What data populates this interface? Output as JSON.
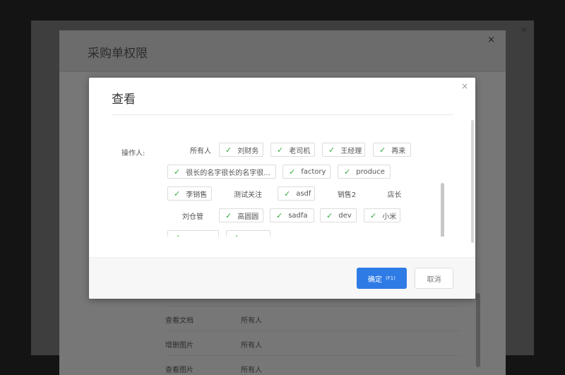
{
  "background_modal": {
    "title": "采购单权限",
    "close_icon": "×",
    "rows": [
      {
        "key": "查看文档",
        "value": "所有人"
      },
      {
        "key": "增删图片",
        "value": "所有人"
      },
      {
        "key": "查看图片",
        "value": "所有人"
      }
    ]
  },
  "dialog": {
    "title": "查看",
    "close_icon": "×",
    "field_label": "操作人:",
    "options": [
      {
        "label": "所有人",
        "checked": false
      },
      {
        "label": "刘财务",
        "checked": true
      },
      {
        "label": "老司机",
        "checked": true
      },
      {
        "label": "王经理",
        "checked": true
      },
      {
        "label": "再来",
        "checked": true
      },
      {
        "label": "很长的名字很长的名字很...",
        "checked": true
      },
      {
        "label": "factory",
        "checked": true
      },
      {
        "label": "produce",
        "checked": true
      },
      {
        "label": "李销售",
        "checked": true
      },
      {
        "label": "测试关注",
        "checked": false
      },
      {
        "label": "asdf",
        "checked": true
      },
      {
        "label": "销售2",
        "checked": false
      },
      {
        "label": "店长",
        "checked": false
      },
      {
        "label": "刘仓管",
        "checked": false
      },
      {
        "label": "高圆圆",
        "checked": true
      },
      {
        "label": "sadfa",
        "checked": true
      },
      {
        "label": "dev",
        "checked": true
      },
      {
        "label": "小米",
        "checked": true
      },
      {
        "label": "",
        "checked": true
      },
      {
        "label": "",
        "checked": true
      }
    ],
    "confirm_label": "确定",
    "confirm_hotkey": "(F1)",
    "cancel_label": "取消",
    "check_glyph": "✓"
  },
  "colors": {
    "primary": "#2e7be6",
    "check": "#2fab3a",
    "overlay": "#141414"
  }
}
